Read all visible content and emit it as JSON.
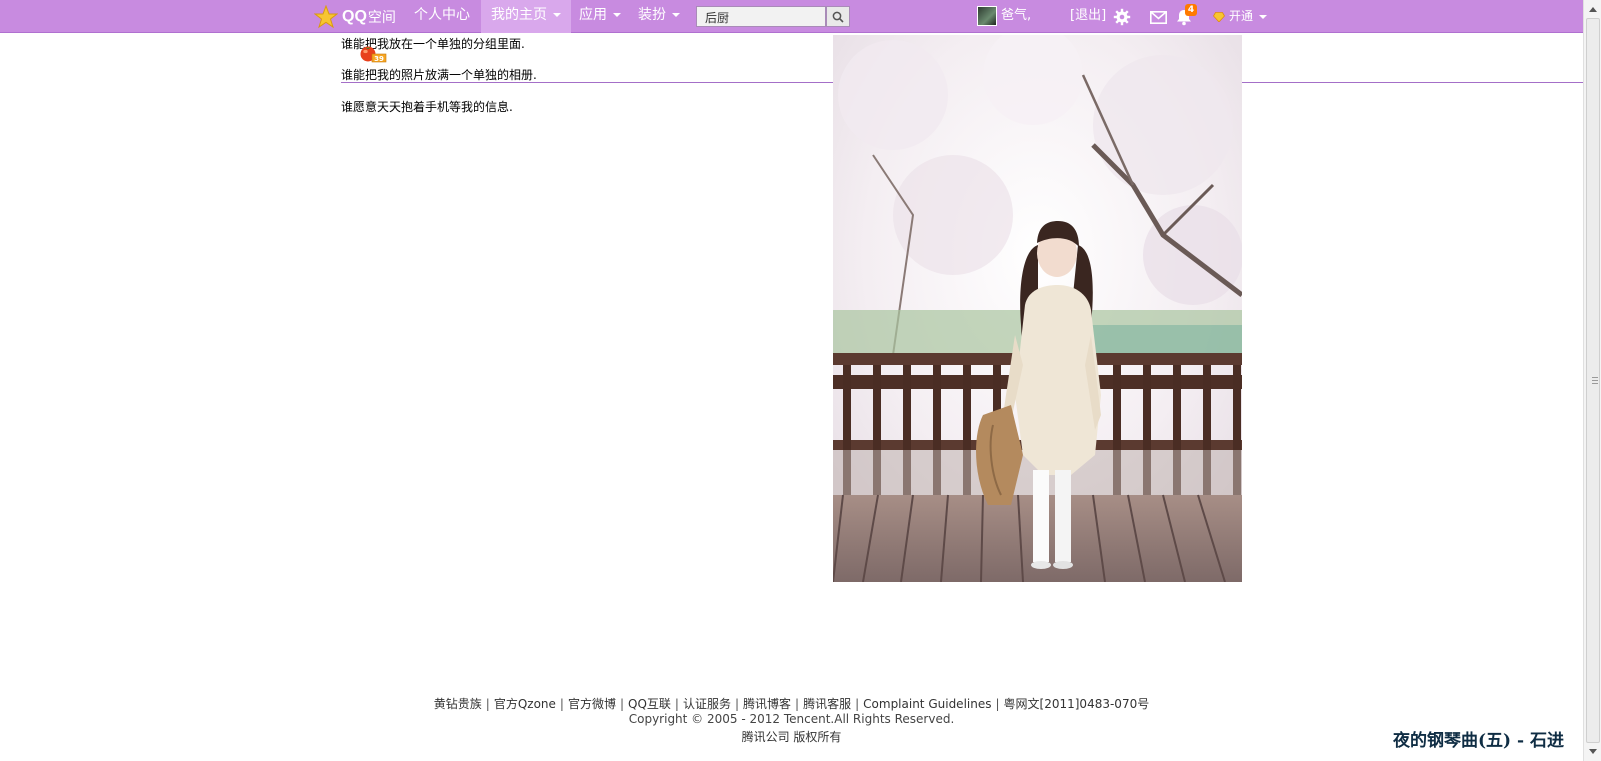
{
  "topbar": {
    "logo_qq": "QQ",
    "logo_kj": "空间",
    "nav": [
      {
        "label": "个人中心",
        "dropdown": false,
        "active": false
      },
      {
        "label": "我的主页",
        "dropdown": true,
        "active": true
      },
      {
        "label": "应用",
        "dropdown": true,
        "active": false
      },
      {
        "label": "装扮",
        "dropdown": true,
        "active": false
      }
    ],
    "search_value": "后厨",
    "user_name": "爸气,",
    "logout_label": "[退出]",
    "notification_count": "4",
    "vip_label": "开通",
    "icons": [
      "star-logo-icon",
      "search-icon",
      "gear-icon",
      "mail-icon",
      "notification-icon",
      "yellow-diamond-icon"
    ],
    "colors": {
      "bar": "#c88be0",
      "active_tab": "#d9a8ec",
      "badge": "#ff7a00"
    }
  },
  "content": {
    "lines": [
      "谁能把我放在一个单独的分组里面.",
      "谁能把我的照片放满一个单独的相册.",
      "谁愿意天天抱着手机等我的信息."
    ],
    "sticker_number": "39",
    "divider_color": "#a46fc8"
  },
  "footer": {
    "links": [
      "黄钻贵族",
      "官方Qzone",
      "官方微博",
      "QQ互联",
      "认证服务",
      "腾讯博客",
      "腾讯客服",
      "Complaint Guidelines",
      "粤网文[2011]0483-070号"
    ],
    "copyright": "Copyright © 2005 - 2012 Tencent.All Rights Reserved.",
    "rights": "腾讯公司 版权所有"
  },
  "music": {
    "now_playing": "夜的钢琴曲(五) - 石进"
  }
}
